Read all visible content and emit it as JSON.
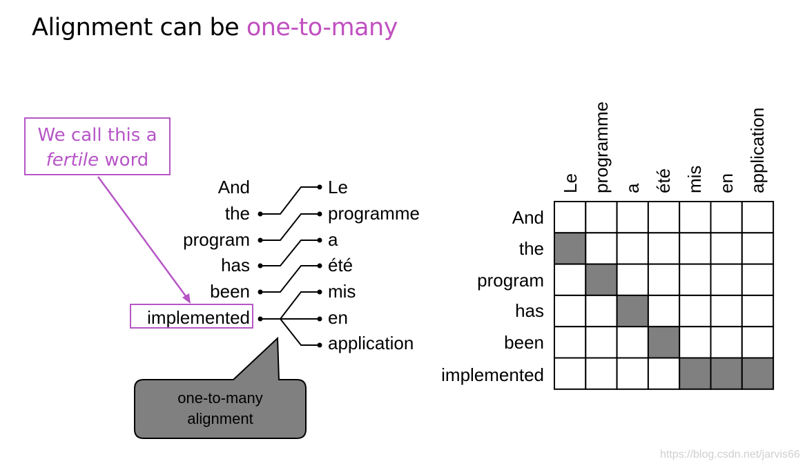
{
  "title": {
    "main": "Alignment can be ",
    "accent": "one-to-many"
  },
  "callout": {
    "line1": "We call this a",
    "italic": "fertile",
    "rest": " word"
  },
  "english_words": [
    "And",
    "the",
    "program",
    "has",
    "been",
    "implemented"
  ],
  "french_words": [
    "Le",
    "programme",
    "a",
    "été",
    "mis",
    "en",
    "application"
  ],
  "bubble": {
    "line1": "one-to-many",
    "line2": "alignment"
  },
  "matrix": {
    "rows": [
      "And",
      "the",
      "program",
      "has",
      "been",
      "implemented"
    ],
    "columns": [
      "Le",
      "programme",
      "a",
      "été",
      "mis",
      "en",
      "application"
    ],
    "filled": [
      [
        1,
        0
      ],
      [
        2,
        1
      ],
      [
        3,
        2
      ],
      [
        4,
        3
      ],
      [
        5,
        4
      ],
      [
        5,
        5
      ],
      [
        5,
        6
      ]
    ]
  },
  "colors": {
    "accent": "#c050c0",
    "box": "#b655c6",
    "cell_fill": "#808080",
    "bubble_fill": "#808080"
  },
  "watermark": "https://blog.csdn.net/jarvis66"
}
